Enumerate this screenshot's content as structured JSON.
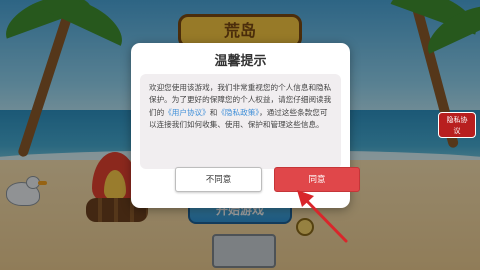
{
  "game": {
    "logo_text": "荒岛",
    "start_button_label": "开始游戏",
    "privacy_badge_label": "隐私协议"
  },
  "dialog": {
    "title": "温馨提示",
    "body": {
      "part1": "欢迎您使用该游戏，我们非常重视您的个人信息和隐私保护。为了更好的保障您的个人权益，请您仔细阅读我们的",
      "user_agreement_link": "《用户协议》",
      "part2": "和",
      "privacy_policy_link": "《隐私政策》",
      "part3": "，通过这些条款您可以连接我们如何收集、使用、保护和管理这些信息。"
    },
    "decline_label": "不同意",
    "agree_label": "同意"
  },
  "colors": {
    "agree_button": "#e0474a",
    "link": "#3f8fd8",
    "arrow": "#d9262b"
  },
  "icons": {
    "tutorial_pointer": "red-arrow-icon"
  }
}
